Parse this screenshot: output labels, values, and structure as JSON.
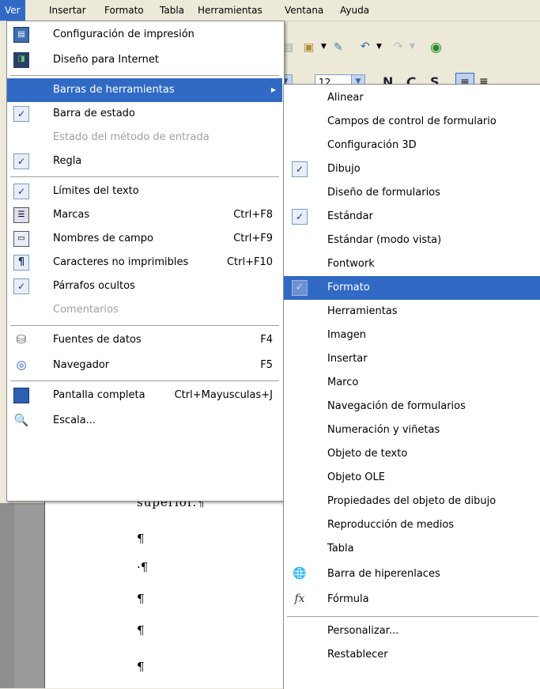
{
  "menubar": {
    "items": [
      {
        "label": "Ver"
      },
      {
        "label": "Insertar"
      },
      {
        "label": "Formato"
      },
      {
        "label": "Tabla"
      },
      {
        "label": "Herramientas"
      },
      {
        "label": "Ventana"
      },
      {
        "label": "Ayuda"
      }
    ]
  },
  "toolbar": {
    "font_size_value": "12",
    "bold_label": "N",
    "italic_label": "C",
    "underline_label": "S"
  },
  "document": {
    "lines": [
      "superior.¶",
      "¶",
      "·¶",
      "¶",
      "¶",
      "¶"
    ]
  },
  "ver_menu": {
    "items": [
      {
        "label": "Configuración de impresión",
        "icon": "print-layout-icon"
      },
      {
        "label": "Diseño para Internet",
        "icon": "web-layout-icon"
      },
      {
        "label": "Barras de herramientas",
        "submenu": true
      },
      {
        "label": "Barra de estado",
        "checked": true
      },
      {
        "label": "Estado del método de entrada",
        "disabled": true
      },
      {
        "label": "Regla",
        "checked": true
      },
      {
        "label": "Límites del texto",
        "checked": true
      },
      {
        "label": "Marcas",
        "shortcut": "Ctrl+F8",
        "icon": "field-shadings-icon"
      },
      {
        "label": "Nombres de campo",
        "shortcut": "Ctrl+F9",
        "icon": "field-names-icon"
      },
      {
        "label": "Caracteres no imprimibles",
        "shortcut": "Ctrl+F10",
        "icon": "pilcrow-icon"
      },
      {
        "label": "Párrafos ocultos",
        "checked": true
      },
      {
        "label": "Comentarios",
        "disabled": true
      },
      {
        "label": "Fuentes de datos",
        "shortcut": "F4",
        "icon": "database-icon"
      },
      {
        "label": "Navegador",
        "shortcut": "F5",
        "icon": "navigator-compass-icon"
      },
      {
        "label": "Pantalla completa",
        "shortcut": "Ctrl+Mayusculas+J",
        "icon": "full-screen-icon"
      },
      {
        "label": "Escala...",
        "icon": "zoom-magnifier-icon"
      }
    ]
  },
  "toolbars_submenu": {
    "items": [
      {
        "label": "Alinear"
      },
      {
        "label": "Campos de control de formulario"
      },
      {
        "label": "Configuración 3D"
      },
      {
        "label": "Dibujo",
        "checked": true
      },
      {
        "label": "Diseño de formularios"
      },
      {
        "label": "Estándar",
        "checked": true
      },
      {
        "label": "Estándar (modo vista)"
      },
      {
        "label": "Fontwork"
      },
      {
        "label": "Formato",
        "checked": true,
        "highlighted": true
      },
      {
        "label": "Herramientas"
      },
      {
        "label": "Imagen"
      },
      {
        "label": "Insertar"
      },
      {
        "label": "Marco"
      },
      {
        "label": "Navegación de formularios"
      },
      {
        "label": "Numeración y viñetas"
      },
      {
        "label": "Objeto de texto"
      },
      {
        "label": "Objeto OLE"
      },
      {
        "label": "Propiedades del objeto de dibujo"
      },
      {
        "label": "Reproducción de medios"
      },
      {
        "label": "Tabla"
      },
      {
        "label": "Barra de hiperenlaces",
        "icon": "hyperlink-bar-icon"
      },
      {
        "label": "Fórmula",
        "icon": "formula-fx-icon"
      },
      {
        "label": "Personalizar..."
      },
      {
        "label": "Restablecer"
      }
    ]
  },
  "colors": {
    "highlight": "#316ac5",
    "menubar_bg": "#ece9d8",
    "disabled_text": "#a0a0a0"
  }
}
